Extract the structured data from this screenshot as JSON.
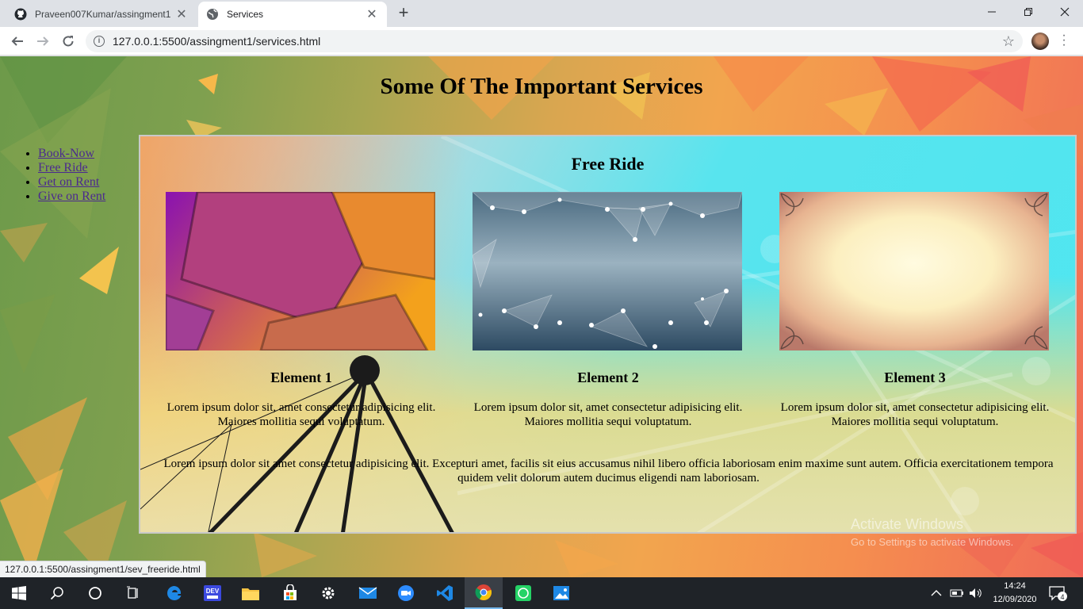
{
  "browser": {
    "tabs": [
      {
        "title": "Praveen007Kumar/assingment1",
        "active": false,
        "icon": "github-icon"
      },
      {
        "title": "Services",
        "active": true,
        "icon": "globe-icon"
      }
    ],
    "url": "127.0.0.1:5500/assingment1/services.html",
    "status_url": "127.0.0.1:5500/assingment1/sev_freeride.html"
  },
  "page": {
    "title": "Some Of The Important Services",
    "nav": [
      "Book-Now",
      "Free Ride",
      "Get on Rent",
      "Give on Rent"
    ],
    "section_title": "Free Ride",
    "cards": [
      {
        "heading": "Element 1",
        "text": "Lorem ipsum dolor sit, amet consectetur adipisicing elit. Maiores mollitia sequi voluptatum."
      },
      {
        "heading": "Element 2",
        "text": "Lorem ipsum dolor sit, amet consectetur adipisicing elit. Maiores mollitia sequi voluptatum."
      },
      {
        "heading": "Element 3",
        "text": "Lorem ipsum dolor sit, amet consectetur adipisicing elit. Maiores mollitia sequi voluptatum."
      }
    ],
    "paragraph": "Lorem ipsum dolor sit amet consectetur adipisicing elit. Excepturi amet, facilis sit eius accusamus nihil libero officia laboriosam enim maxime sunt autem. Officia exercitationem tempora quidem velit dolorum autem ducimus eligendi nam laboriosam."
  },
  "watermark": {
    "line1": "Activate Windows",
    "line2": "Go to Settings to activate Windows."
  },
  "taskbar": {
    "apps": [
      "start-icon",
      "search-icon",
      "cortana-icon",
      "task-view-icon",
      "edge-icon",
      "dev-icon",
      "file-explorer-icon",
      "store-icon",
      "settings-icon",
      "mail-icon",
      "zoom-icon",
      "vscode-icon",
      "chrome-icon",
      "whatsapp-icon",
      "photos-icon"
    ],
    "time": "14:24",
    "date": "12/09/2020",
    "notifications": "4"
  },
  "colors": {
    "accent": "#76b9ed",
    "link": "#4b2a8f"
  }
}
